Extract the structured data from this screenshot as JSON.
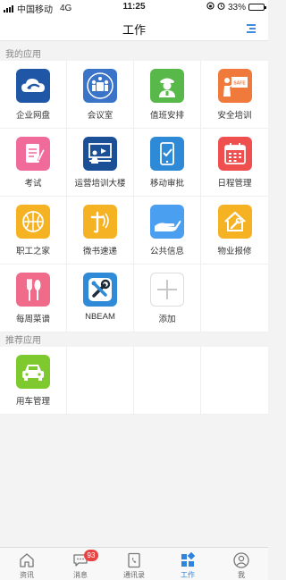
{
  "status": {
    "carrier": "中国移动",
    "network": "4G",
    "time": "11:25",
    "battery": "33%",
    "battery_level": 0.33
  },
  "header": {
    "title": "工作"
  },
  "sections": [
    {
      "title": "我的应用",
      "apps": [
        {
          "label": "企业网盘",
          "icon": "cloud-disk-icon",
          "color": "#1f56a6"
        },
        {
          "label": "会议室",
          "icon": "meeting-room-icon",
          "color": "#3a74c8"
        },
        {
          "label": "值班安排",
          "icon": "duty-officer-icon",
          "color": "#58b84a"
        },
        {
          "label": "安全培训",
          "icon": "safety-training-icon",
          "color": "#f07a3c"
        },
        {
          "label": "考试",
          "icon": "exam-icon",
          "color": "#f06a9a"
        },
        {
          "label": "运营培训大楼",
          "icon": "training-building-icon",
          "color": "#1b4f96"
        },
        {
          "label": "移动审批",
          "icon": "mobile-approval-icon",
          "color": "#2e8ad6"
        },
        {
          "label": "日程管理",
          "icon": "calendar-icon",
          "color": "#ef4f4f"
        },
        {
          "label": "职工之家",
          "icon": "basketball-icon",
          "color": "#f5b324"
        },
        {
          "label": "微书速递",
          "icon": "book-express-icon",
          "color": "#f5b324"
        },
        {
          "label": "公共信息",
          "icon": "hand-info-icon",
          "color": "#4a9ff0"
        },
        {
          "label": "物业报修",
          "icon": "repair-house-icon",
          "color": "#f5b324"
        },
        {
          "label": "每周菜谱",
          "icon": "fork-spoon-icon",
          "color": "#f06a8a"
        },
        {
          "label": "NBEAM",
          "icon": "tools-icon",
          "color": "#2f8bd8"
        },
        {
          "label": "添加",
          "icon": "add-icon",
          "color": "#ffffff"
        }
      ]
    },
    {
      "title": "推荐应用",
      "apps": [
        {
          "label": "用车管理",
          "icon": "car-icon",
          "color": "#7dc92e"
        }
      ]
    }
  ],
  "tabbar": [
    {
      "label": "资讯",
      "icon": "home-icon",
      "active": false
    },
    {
      "label": "消息",
      "icon": "chat-icon",
      "active": false,
      "badge": "93"
    },
    {
      "label": "通讯录",
      "icon": "phone-book-icon",
      "active": false
    },
    {
      "label": "工作",
      "icon": "work-grid-icon",
      "active": true
    },
    {
      "label": "我",
      "icon": "user-icon",
      "active": false
    }
  ]
}
